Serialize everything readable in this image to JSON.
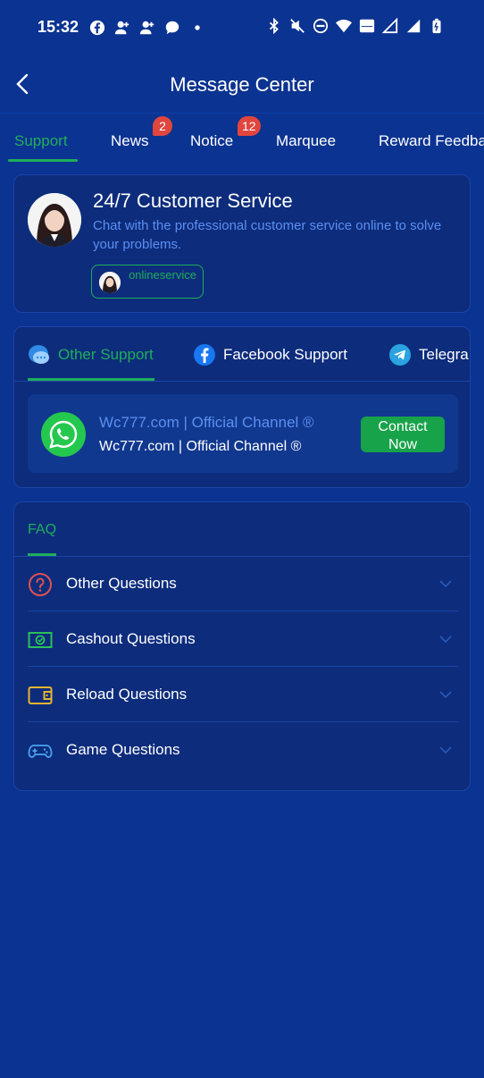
{
  "status_bar": {
    "time": "15:32",
    "left_icons": [
      "facebook-icon",
      "person-add-icon",
      "person-add-icon",
      "chat-bubble-icon",
      "dot-icon"
    ],
    "right_icons": [
      "bluetooth-icon",
      "mute-icon",
      "dnd-icon",
      "wifi-icon",
      "vowifi-icon",
      "signal-icon",
      "signal-icon",
      "battery-icon"
    ]
  },
  "header": {
    "title": "Message Center"
  },
  "tabs": [
    {
      "label": "Support",
      "active": true
    },
    {
      "label": "News",
      "badge": "2"
    },
    {
      "label": "Notice",
      "badge": "12"
    },
    {
      "label": "Marquee"
    },
    {
      "label": "Reward Feedba"
    }
  ],
  "customer_service": {
    "title": "24/7 Customer Service",
    "description": "Chat with the professional customer service online to solve your problems.",
    "online_label": "onlineservice"
  },
  "support_tabs": [
    {
      "label": "Other Support",
      "icon": "chat-icon",
      "active": true
    },
    {
      "label": "Facebook Support",
      "icon": "facebook-icon"
    },
    {
      "label": "Telegra",
      "icon": "telegram-icon"
    }
  ],
  "channel": {
    "title": "Wc777.com | Official Channel ®",
    "subtitle": "Wc777.com | Official Channel ®",
    "button_label": "Contact Now",
    "icon": "whatsapp-icon"
  },
  "faq": {
    "tab_label": "FAQ",
    "items": [
      {
        "label": "Other Questions",
        "icon": "question-icon"
      },
      {
        "label": "Cashout Questions",
        "icon": "cash-icon"
      },
      {
        "label": "Reload Questions",
        "icon": "wallet-icon"
      },
      {
        "label": "Game Questions",
        "icon": "gamepad-icon"
      }
    ]
  },
  "colors": {
    "background": "#0b3391",
    "card": "#0d2c7c",
    "accent_green": "#1fae5b",
    "link_blue": "#5b8ff0",
    "badge_red": "#e0463e"
  }
}
